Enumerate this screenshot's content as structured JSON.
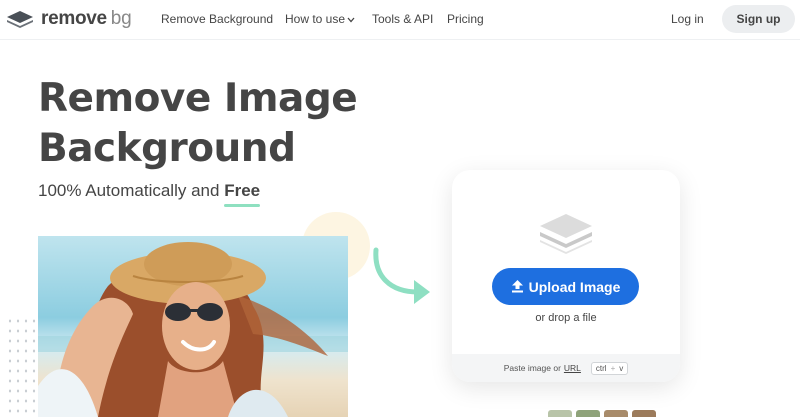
{
  "nav": {
    "logo_main": "remove",
    "logo_bg": "bg",
    "links": {
      "remove_background": "Remove Background",
      "how_to_use": "How to use",
      "tools_api": "Tools & API",
      "pricing": "Pricing"
    },
    "login": "Log in",
    "signup": "Sign up"
  },
  "hero": {
    "title_line1": "Remove Image",
    "title_line2": "Background",
    "subtitle_prefix": "100% Automatically and",
    "subtitle_free": "Free"
  },
  "upload": {
    "button": "Upload Image",
    "drop_text": "or drop a file",
    "paste_prefix": "Paste image or",
    "paste_url": "URL",
    "kbd_ctrl": "ctrl",
    "kbd_plus": "+",
    "kbd_v": "v"
  },
  "colors": {
    "primary": "#1e6fe0",
    "accent_underline": "#8ee0c0",
    "arrow": "#8edfc2",
    "text": "#454545"
  },
  "icons": [
    "logo-stack-icon",
    "chevron-down-icon",
    "upload-arrow-icon",
    "image-stack-icon",
    "curved-arrow-icon"
  ]
}
